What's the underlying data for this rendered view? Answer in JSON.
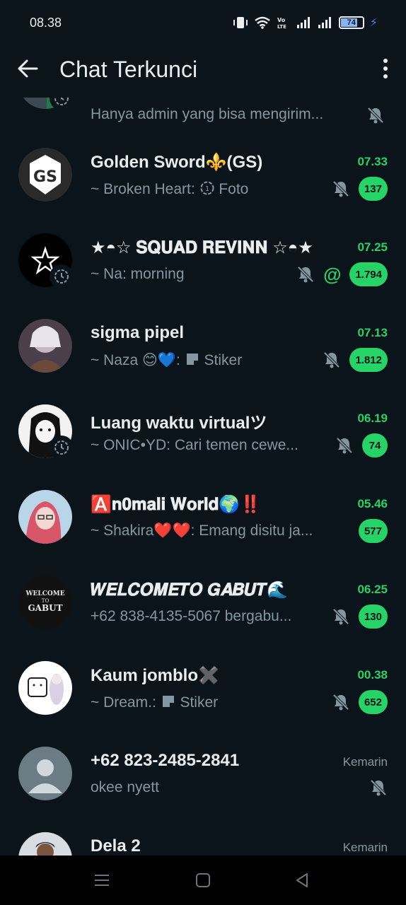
{
  "status": {
    "time": "08.38",
    "battery": "74",
    "battery_level": 0.74
  },
  "header": {
    "title": "Chat Terkunci",
    "back_icon": "arrow-left-icon",
    "menu_icon": "more-vertical-icon"
  },
  "partial_top": {
    "preview": "Hanya admin yang bisa mengirim..."
  },
  "chats": [
    {
      "name": "Golden Sword⚜️(GS)",
      "time": "07.33",
      "preview_sender": "~ Broken Heart:",
      "preview_text": "Foto",
      "preview_icon": "photo-icon",
      "muted": true,
      "unread": "137"
    },
    {
      "name": "★◓☆ 𝐒𝐐𝐔𝐀𝐃 𝐑𝐄𝐕𝐈𝐍𝐍 ☆◓★",
      "time": "07.25",
      "preview_sender": "~ Na:",
      "preview_text": "morning",
      "muted": true,
      "mention": "@",
      "unread": "1.794"
    },
    {
      "name": "sigma pipel",
      "time": "07.13",
      "preview_sender": "~ Naza 😊💙:",
      "preview_text": "Stiker",
      "preview_icon": "sticker-icon",
      "muted": true,
      "unread": "1.812"
    },
    {
      "name": "Luang waktu virtualツ",
      "time": "06.19",
      "preview_sender": "~ ONIC•YD:",
      "preview_text": "Cari temen cewe...",
      "muted": true,
      "unread": "74"
    },
    {
      "name": "🅰️𝐧𝟎𝐦𝐚𝐥𝐢 𝐖𝐨𝐫𝐥𝐝🌍‼️",
      "time": "05.46",
      "preview_sender": "~ Shakira❤️❤️:",
      "preview_text": "Emang disitu ja...",
      "muted": false,
      "unread": "577"
    },
    {
      "name": "𝑾𝑬𝑳𝑪𝑶𝑴𝑬𝑻𝑶  𝑮𝑨𝑩𝑼𝑻🌊",
      "time": "06.25",
      "preview_sender": "",
      "preview_text": "+62 838-4135-5067 bergabu...",
      "muted": true,
      "unread": "130"
    },
    {
      "name": "Kaum jomblo✖️",
      "time": "00.38",
      "preview_sender": "~ Dream.:",
      "preview_text": "Stiker",
      "preview_icon": "sticker-icon",
      "muted": true,
      "unread": "652"
    },
    {
      "name": "+62 823-2485-2841",
      "time": "Kemarin",
      "preview_sender": "",
      "preview_text": "okee nyett",
      "muted": true,
      "unread": ""
    },
    {
      "name": "Dela 2",
      "time": "Kemarin",
      "preview_sender": "",
      "preview_text": "",
      "muted": false,
      "unread": ""
    }
  ],
  "colors": {
    "background": "#0b141a",
    "accent": "#25d366",
    "muted_text": "#8696a0"
  }
}
